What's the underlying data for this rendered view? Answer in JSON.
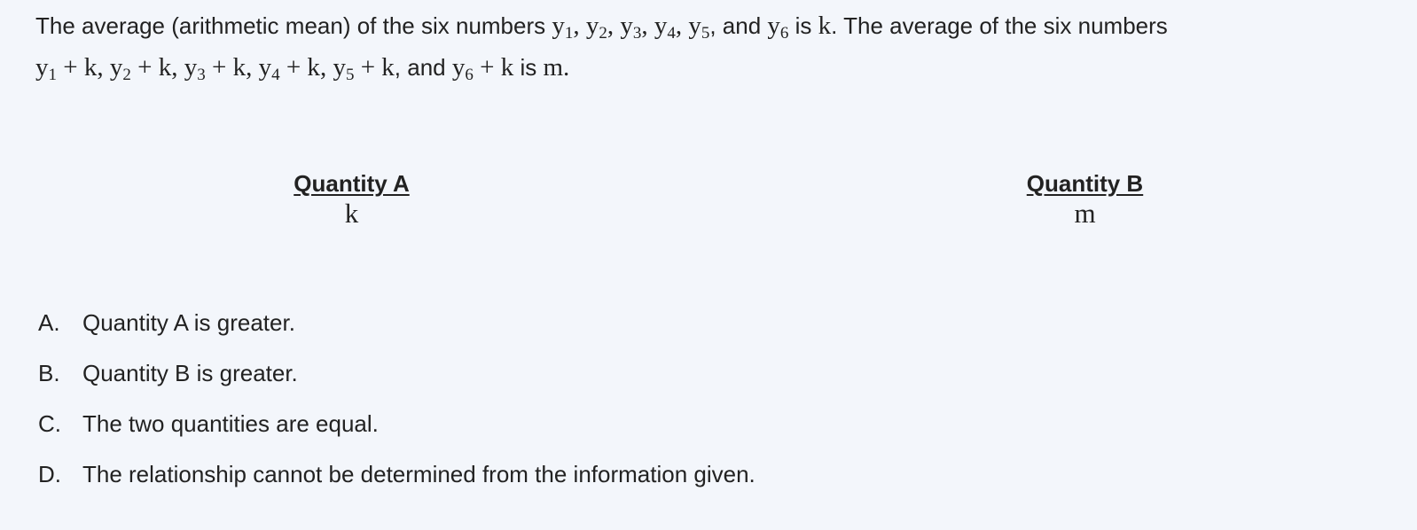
{
  "question": {
    "line1": {
      "t1": "The average (arithmetic mean) of the six numbers ",
      "y": "y",
      "s1": "1",
      "s2": "2",
      "s3": "3",
      "s4": "4",
      "s5": "5",
      "s6": "6",
      "comma": ", ",
      "and": ", and ",
      "is": " is ",
      "k": "k",
      "t2": ". The average of the six numbers"
    },
    "line2": {
      "plusk": " + k",
      "comma": ", ",
      "and": ", and ",
      "ismtxt": " is ",
      "m": "m",
      "period": "."
    }
  },
  "quantity_a": {
    "label": "Quantity A",
    "value": "k"
  },
  "quantity_b": {
    "label": "Quantity B",
    "value": "m"
  },
  "choices": [
    {
      "letter": "A.",
      "text": "Quantity A is greater."
    },
    {
      "letter": "B.",
      "text": "Quantity B is greater."
    },
    {
      "letter": "C.",
      "text": "The two quantities are equal."
    },
    {
      "letter": "D.",
      "text": "The relationship cannot be determined from the information given."
    }
  ]
}
